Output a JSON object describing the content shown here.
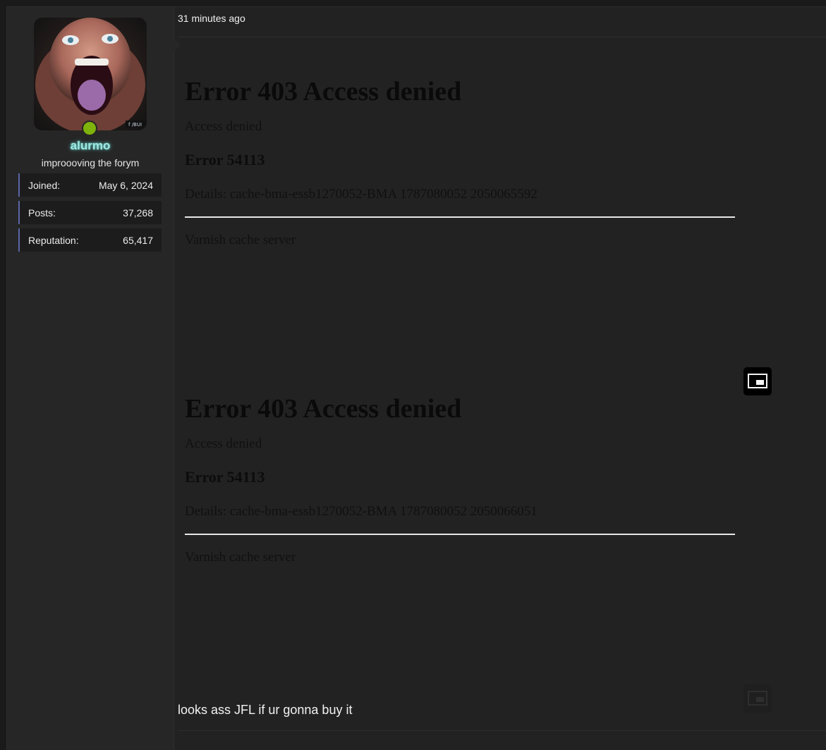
{
  "user": {
    "avatar_icon": "user-avatar-photo",
    "status_color": "#7fb20b",
    "username": "alurmo",
    "username_color": "#9ee7e2",
    "title": "improooving the forym",
    "stats": [
      {
        "label": "Joined:",
        "value": "May 6, 2024"
      },
      {
        "label": "Posts:",
        "value": "37,268"
      },
      {
        "label": "Reputation:",
        "value": "65,417"
      }
    ]
  },
  "post": {
    "timestamp": "31 minutes ago",
    "embeds": [
      {
        "heading": "Error 403 Access denied",
        "text1": "Access denied",
        "subheading": "Error 54113",
        "details": "Details: cache-bma-essb1270052-BMA 1787080052 2050065592",
        "footer": "Varnish cache server",
        "pip_icon": "picture-in-picture-icon"
      },
      {
        "heading": "Error 403 Access denied",
        "text1": "Access denied",
        "subheading": "Error 54113",
        "details": "Details: cache-bma-essb1270052-BMA 1787080052 2050066051",
        "footer": "Varnish cache server",
        "pip_icon": "picture-in-picture-icon"
      }
    ],
    "body_text": "looks ass JFL if ur gonna buy it"
  }
}
